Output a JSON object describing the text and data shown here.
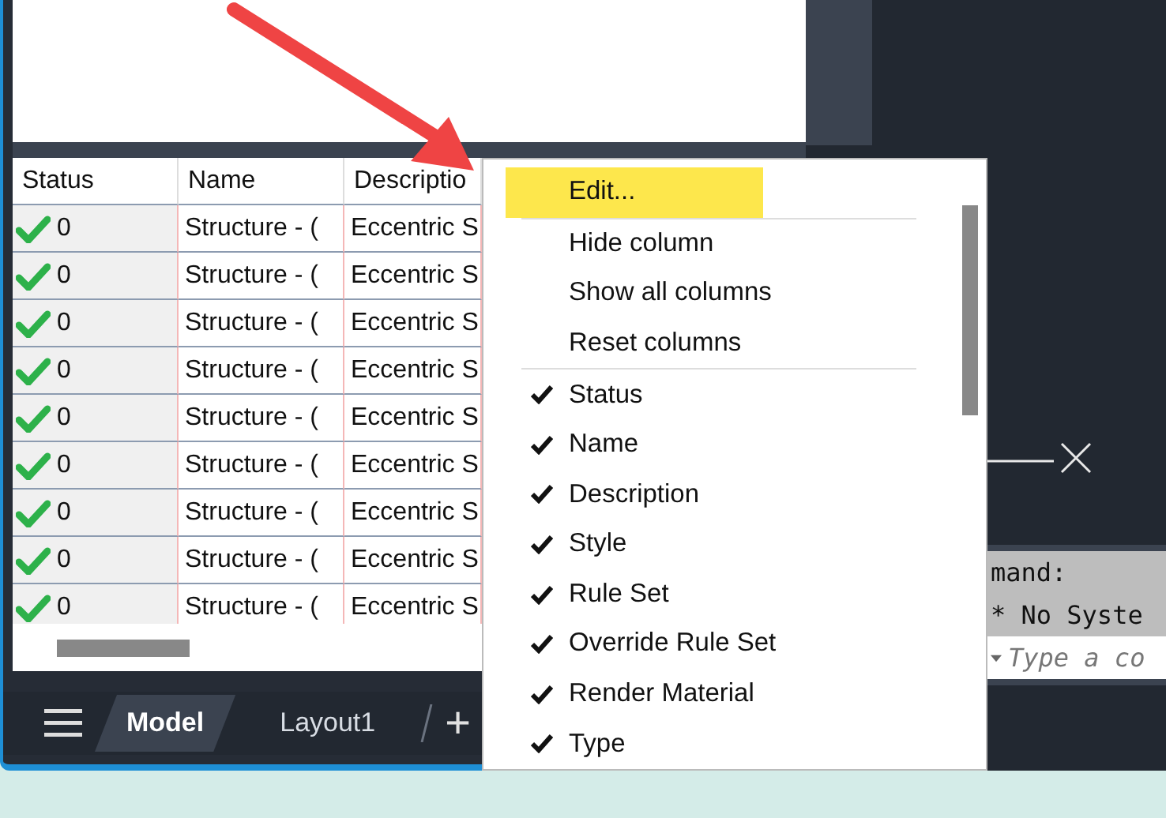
{
  "table": {
    "columns": [
      "Status",
      "Name",
      "Descriptio"
    ],
    "rows": [
      {
        "status": "0",
        "name": "Structure - (",
        "description": "Eccentric S"
      },
      {
        "status": "0",
        "name": "Structure - (",
        "description": "Eccentric S"
      },
      {
        "status": "0",
        "name": "Structure - (",
        "description": "Eccentric S"
      },
      {
        "status": "0",
        "name": "Structure - (",
        "description": "Eccentric S"
      },
      {
        "status": "0",
        "name": "Structure - (",
        "description": "Eccentric S"
      },
      {
        "status": "0",
        "name": "Structure - (",
        "description": "Eccentric S"
      },
      {
        "status": "0",
        "name": "Structure - (",
        "description": "Eccentric S"
      },
      {
        "status": "0",
        "name": "Structure - (",
        "description": "Eccentric S"
      },
      {
        "status": "0",
        "name": "Structure - (",
        "description": "Eccentric S"
      }
    ]
  },
  "layout_tabs": [
    {
      "label": "Model",
      "selected": true
    },
    {
      "label": "Layout1",
      "selected": false
    }
  ],
  "add_tab": "+",
  "context_menu": {
    "items": [
      {
        "kind": "action",
        "label": "Edit...",
        "highlighted": true
      },
      {
        "kind": "separator"
      },
      {
        "kind": "action",
        "label": "Hide column",
        "highlighted": false
      },
      {
        "kind": "action",
        "label": "Show all columns",
        "highlighted": false
      },
      {
        "kind": "action",
        "label": "Reset columns",
        "highlighted": false
      },
      {
        "kind": "separator"
      },
      {
        "kind": "toggle",
        "label": "Status",
        "checked": true
      },
      {
        "kind": "toggle",
        "label": "Name",
        "checked": true
      },
      {
        "kind": "toggle",
        "label": "Description",
        "checked": true
      },
      {
        "kind": "toggle",
        "label": "Style",
        "checked": true
      },
      {
        "kind": "toggle",
        "label": "Rule Set",
        "checked": true
      },
      {
        "kind": "toggle",
        "label": "Override Rule Set",
        "checked": true
      },
      {
        "kind": "toggle",
        "label": "Render Material",
        "checked": true
      },
      {
        "kind": "toggle",
        "label": "Type",
        "checked": true
      }
    ]
  },
  "command_line": {
    "history": [
      "mand:",
      "* No Syste"
    ],
    "placeholder": "Type a co"
  }
}
